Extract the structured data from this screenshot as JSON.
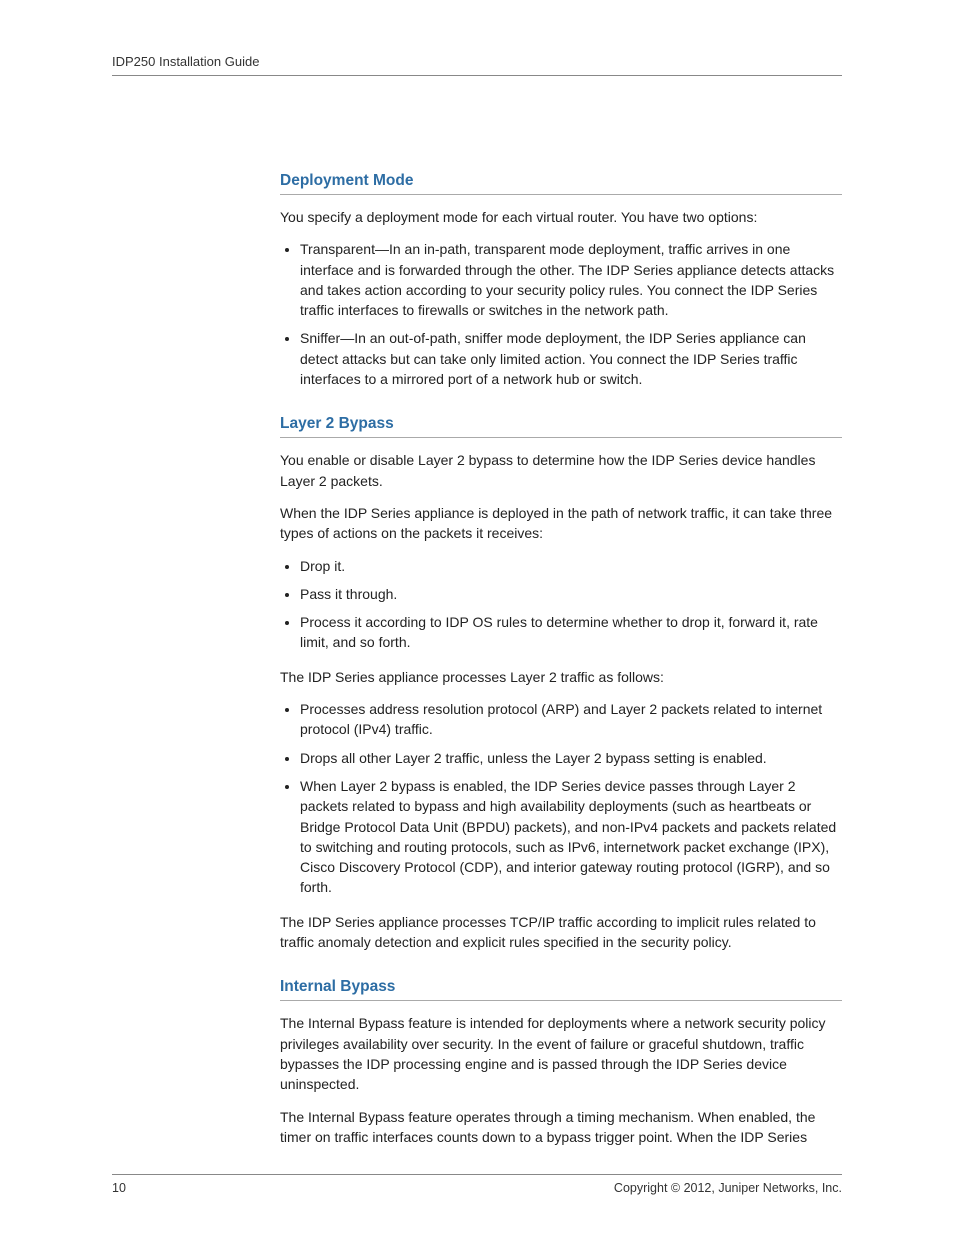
{
  "header": {
    "running_head": "IDP250 Installation Guide"
  },
  "sections": {
    "deployment_mode": {
      "title": "Deployment Mode",
      "intro": "You specify a deployment mode for each virtual router. You have two options:",
      "items": [
        "Transparent—In an in-path, transparent mode deployment, traffic arrives in one interface and is forwarded through the other. The IDP Series appliance detects attacks and takes action according to your security policy rules. You connect the IDP Series traffic interfaces to firewalls or switches in the network path.",
        "Sniffer—In an out-of-path, sniffer mode deployment, the IDP Series appliance can detect attacks but can take only limited action. You connect the IDP Series traffic interfaces to a mirrored port of a network hub or switch."
      ]
    },
    "layer2_bypass": {
      "title": "Layer 2 Bypass",
      "intro1": "You enable or disable Layer 2 bypass to determine how the IDP Series device handles Layer 2 packets.",
      "intro2": "When the IDP Series appliance is deployed in the path of network traffic, it can take three types of actions on the packets it receives:",
      "actions": [
        "Drop it.",
        "Pass it through.",
        "Process it according to IDP OS rules to determine whether to drop it, forward it, rate limit, and so forth."
      ],
      "mid": "The IDP Series appliance processes Layer 2 traffic as follows:",
      "processing": [
        "Processes address resolution protocol (ARP) and Layer 2 packets related to internet protocol (IPv4) traffic.",
        "Drops all other Layer 2 traffic, unless the Layer 2 bypass setting is enabled.",
        "When Layer 2 bypass is enabled, the IDP Series device passes through Layer 2 packets related to bypass and high availability deployments (such as heartbeats or Bridge Protocol Data Unit (BPDU) packets), and non-IPv4 packets and packets related to switching and routing protocols, such as IPv6, internetwork packet exchange (IPX), Cisco Discovery Protocol (CDP), and interior gateway routing protocol (IGRP), and so forth."
      ],
      "outro": "The IDP Series appliance processes TCP/IP traffic according to implicit rules related to traffic anomaly detection and explicit rules specified in the security policy."
    },
    "internal_bypass": {
      "title": "Internal Bypass",
      "p1": "The Internal Bypass feature is intended for deployments where a network security policy privileges availability over security. In the event of failure or graceful shutdown, traffic bypasses the IDP processing engine and is passed through the IDP Series device uninspected.",
      "p2": "The Internal Bypass feature operates through a timing mechanism. When enabled, the timer on traffic interfaces counts down to a bypass trigger point. When the IDP Series"
    }
  },
  "footer": {
    "page_number": "10",
    "copyright": "Copyright © 2012, Juniper Networks, Inc."
  }
}
